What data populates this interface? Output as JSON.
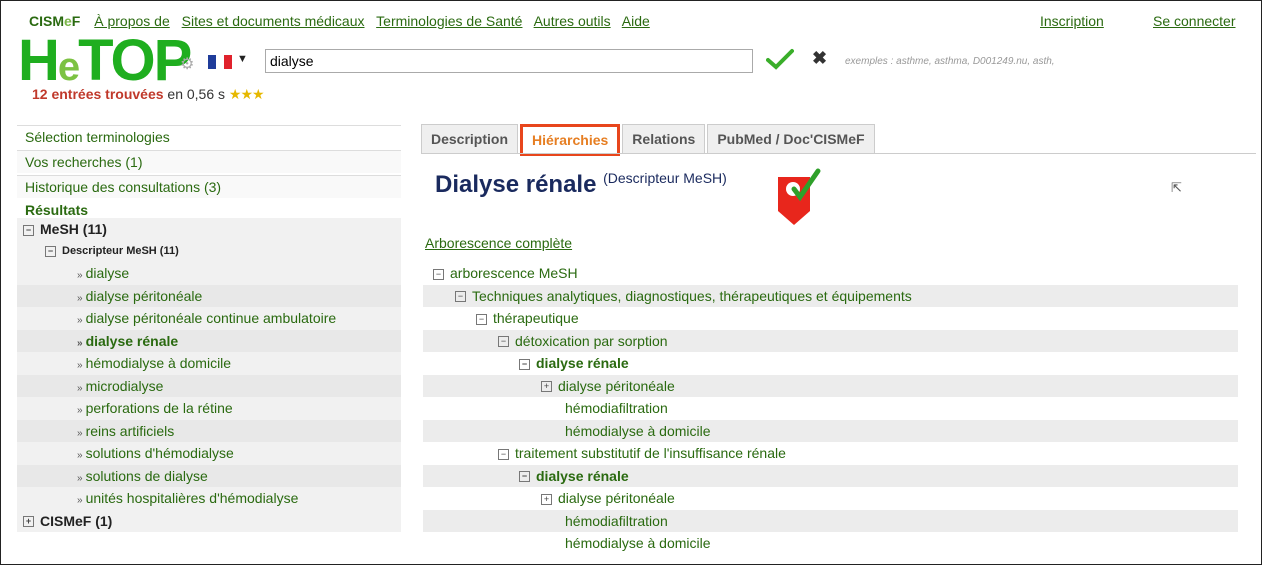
{
  "topnav": {
    "brand": "CISMeF",
    "links": [
      "À propos de",
      "Sites et documents médicaux",
      "Terminologies de Santé",
      "Autres outils",
      "Aide"
    ],
    "inscription": "Inscription",
    "login": "Se connecter"
  },
  "logo": "HeTOP",
  "search": {
    "value": "dialyse",
    "examples": "exemples : asthme, asthma, D001249.nu, asth,"
  },
  "results_count": {
    "entries": "12 entrées trouvées",
    "time": "en 0,56 s",
    "stars": "★★★"
  },
  "sidebar": {
    "items": [
      "Sélection terminologies",
      "Vos recherches (1)",
      "Historique des consultations (3)"
    ],
    "results_label": "Résultats",
    "mesh": "MeSH (11)",
    "descripteur": "Descripteur MeSH (11)",
    "leaves": [
      "dialyse",
      "dialyse péritonéale",
      "dialyse péritonéale continue ambulatoire",
      "dialyse rénale",
      "hémodialyse à domicile",
      "microdialyse",
      "perforations de la rétine",
      "reins artificiels",
      "solutions d'hémodialyse",
      "solutions de dialyse",
      "unités hospitalières d'hémodialyse"
    ],
    "cismef": "CISMeF (1)"
  },
  "tabs": [
    "Description",
    "Hiérarchies",
    "Relations",
    "PubMed / Doc'CISMeF"
  ],
  "active_tab": "Hiérarchies",
  "title": {
    "name": "Dialyse rénale",
    "type": "(Descripteur MeSH)"
  },
  "full_link": "Arborescence complète",
  "hierarchy": [
    "arborescence MeSH",
    "Techniques analytiques, diagnostiques, thérapeutiques et équipements",
    "thérapeutique",
    "détoxication par sorption",
    "dialyse rénale",
    "dialyse péritonéale",
    "hémodiafiltration",
    "hémodialyse à domicile",
    "traitement substitutif de l'insuffisance rénale",
    "dialyse rénale",
    "dialyse péritonéale",
    "hémodiafiltration",
    "hémodialyse à domicile"
  ]
}
